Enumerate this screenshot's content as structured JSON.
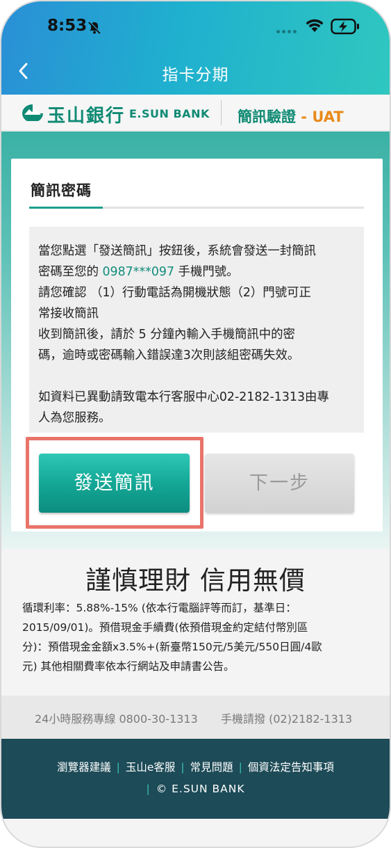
{
  "status_bar": {
    "time": "8:53"
  },
  "nav": {
    "title": "指卡分期"
  },
  "brand": {
    "name_zh": "玉山銀行",
    "name_en": "E.SUN BANK",
    "page_label": "簡訊驗證",
    "dash": " - ",
    "env": "UAT"
  },
  "card": {
    "title": "簡訊密碼",
    "info_line1": "當您點選「發送簡訊」按鈕後，系統會發送一封簡訊",
    "info_line2_prefix": "密碼至您的 ",
    "phone_number": "0987***097",
    "info_line2_suffix": " 手機門號。",
    "info_line3": "請您確認 （1）行動電話為開機狀態（2）門號可正",
    "info_line4": "常接收簡訊",
    "info_line5": "收到簡訊後，請於 5 分鐘內輸入手機簡訊中的密",
    "info_line6": "碼，逾時或密碼輸入錯誤達3次則該組密碼失效。",
    "info_line7": "如資料已異動請致電本行客服中心02-2182-1313由專",
    "info_line8": "人為您服務。"
  },
  "buttons": {
    "send_sms": "發送簡訊",
    "next_step": "下一步"
  },
  "slogan": "謹慎理財  信用無價",
  "rates": {
    "line1": "循環利率：5.88%-15% (依本行電腦評等而訂，基準日：",
    "line2": "2015/09/01)。預借現金手續費(依預借現金約定結付幣別區",
    "line3": "分)：預借現金金額x3.5%+(新臺幣150元/5美元/550日圓/4歐",
    "line4": "元) 其他相關費率依本行網站及申請書公告。"
  },
  "hotline": {
    "service": "24小時服務專線 0800-30-1313",
    "mobile": "手機請撥 (02)2182-1313"
  },
  "footer": {
    "links": [
      "瀏覽器建議",
      "玉山e客服",
      "常見問題",
      "個資法定告知事項"
    ],
    "separator": "|",
    "copyright": "© E.SUN BANK"
  }
}
